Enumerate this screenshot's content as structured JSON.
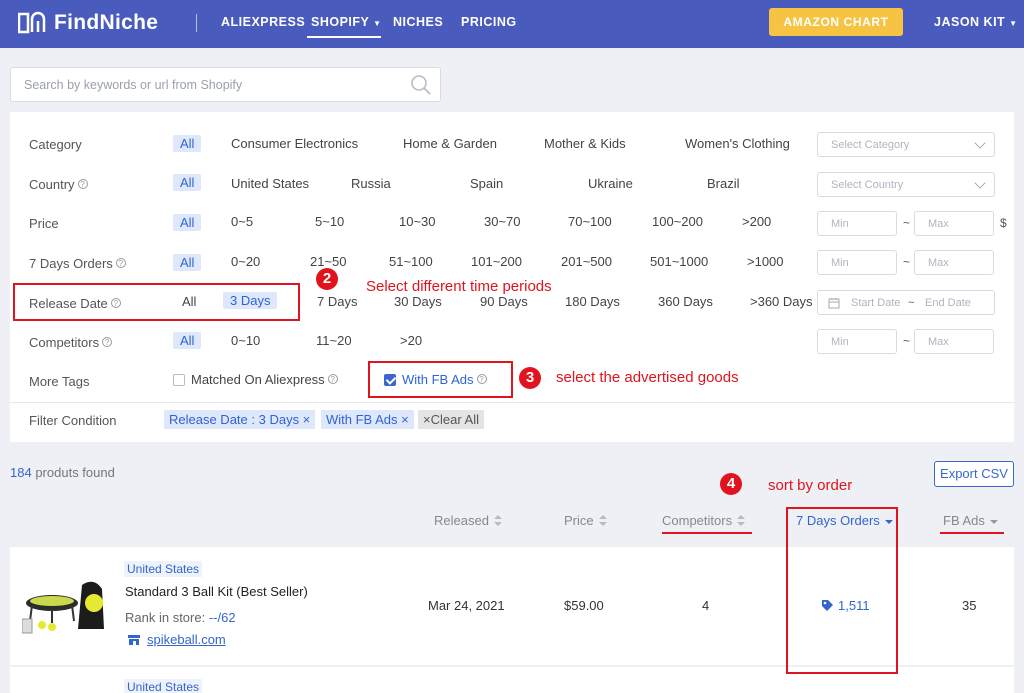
{
  "nav": {
    "brand": "FindNiche",
    "items": [
      "ALIEXPRESS",
      "SHOPIFY",
      "NICHES",
      "PRICING"
    ],
    "amazon_chart": "AMAZON CHART",
    "user": "JASON KIT",
    "accent": "#4a5bbe",
    "button_color": "#f6c343"
  },
  "search": {
    "placeholder": "Search by keywords or url from Shopify"
  },
  "filters": {
    "category": {
      "label": "Category",
      "options": [
        "All",
        "Consumer Electronics",
        "Home & Garden",
        "Mother & Kids",
        "Women's Clothing"
      ],
      "select": "Select Category"
    },
    "country": {
      "label": "Country",
      "options": [
        "All",
        "United States",
        "Russia",
        "Spain",
        "Ukraine",
        "Brazil"
      ],
      "select": "Select Country"
    },
    "price": {
      "label": "Price",
      "options": [
        "All",
        "0~5",
        "5~10",
        "10~30",
        "30~70",
        "70~100",
        "100~200",
        ">200"
      ],
      "min": "Min",
      "max": "Max",
      "unit": "$"
    },
    "orders": {
      "label": "7 Days Orders",
      "options": [
        "All",
        "0~20",
        "21~50",
        "51~100",
        "101~200",
        "201~500",
        "501~1000",
        ">1000"
      ],
      "min": "Min",
      "max": "Max"
    },
    "release": {
      "label": "Release Date",
      "options": [
        "All",
        "3 Days",
        "7 Days",
        "30 Days",
        "90 Days",
        "180 Days",
        "360 Days",
        ">360 Days"
      ],
      "start": "Start Date",
      "end": "End Date"
    },
    "competitors": {
      "label": "Competitors",
      "options": [
        "All",
        "0~10",
        "11~20",
        ">20"
      ],
      "min": "Min",
      "max": "Max"
    },
    "tags": {
      "label": "More Tags",
      "aliexpress": "Matched On Aliexpress",
      "fb_ads": "With FB Ads"
    },
    "condition": {
      "label": "Filter Condition",
      "tag1": "Release Date : 3 Days ×",
      "tag2": "With FB Ads ×",
      "clear": "×Clear All"
    }
  },
  "annotations": {
    "n2": "2",
    "t2": "Select different time periods",
    "n3": "3",
    "t3": "select the advertised goods",
    "n4": "4",
    "t4": "sort by order",
    "color": "#e0141e"
  },
  "results": {
    "count": "184",
    "count_label": "produts found",
    "export": "Export CSV",
    "columns": [
      "Released",
      "Price",
      "Competitors",
      "7 Days Orders",
      "FB Ads"
    ],
    "rows": [
      {
        "country": "United States",
        "title": "Standard 3 Ball Kit (Best Seller)",
        "rank_label": "Rank in store:",
        "rank_value": "--/62",
        "store": "spikeball.com",
        "released": "Mar 24, 2021",
        "price": "$59.00",
        "competitors": "4",
        "orders": "1,511",
        "fb_ads": "35"
      },
      {
        "country": "United States"
      }
    ]
  }
}
